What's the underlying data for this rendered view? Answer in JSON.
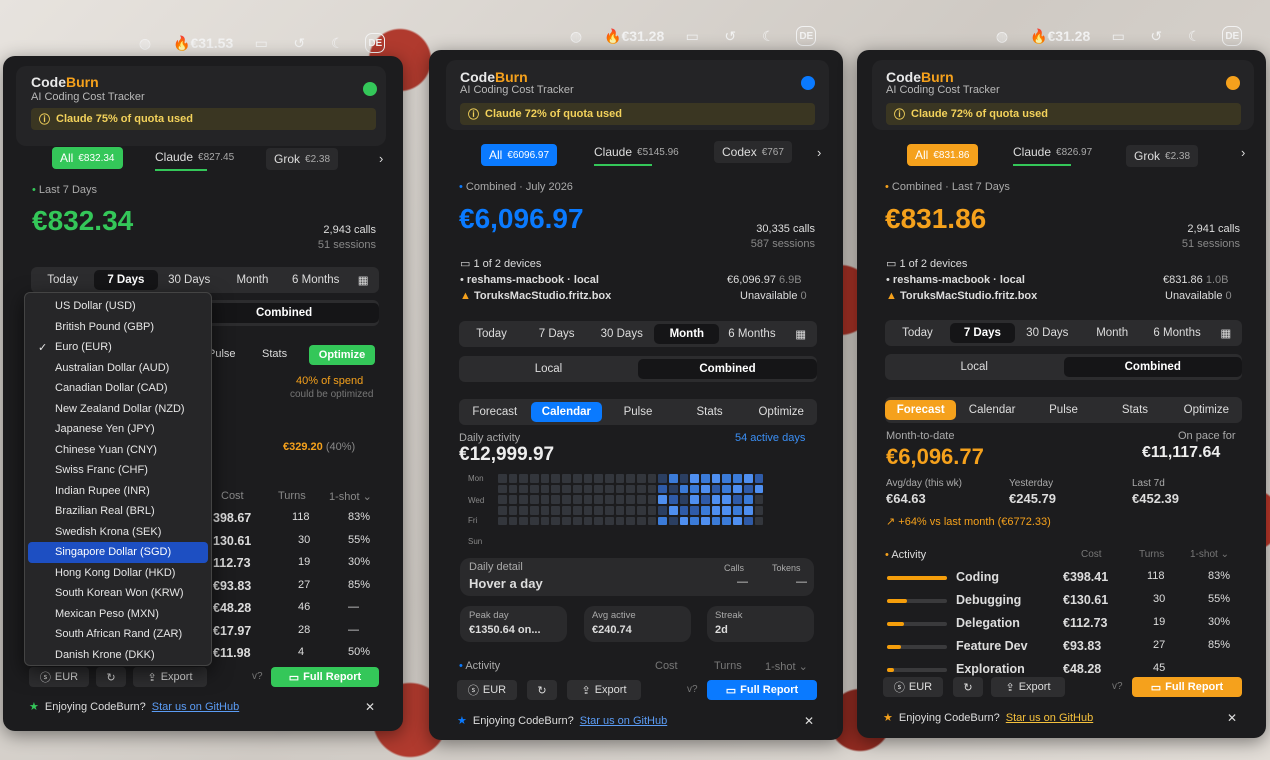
{
  "colors": {
    "green": "#34c759",
    "blue": "#0a7aff",
    "orange": "#f5a11c"
  },
  "app": {
    "brand_code": "Code",
    "brand_burn": "Burn",
    "subtitle": "AI Coding Cost Tracker"
  },
  "p1": {
    "menu_cost": "€31.53",
    "lang": "DE",
    "quota": "Claude 75% of quota used",
    "tabs": [
      {
        "label": "All",
        "value": "€832.34"
      },
      {
        "label": "Claude",
        "value": "€827.45"
      },
      {
        "label": "Grok",
        "value": "€2.38"
      }
    ],
    "period_label": "Last 7 Days",
    "total": "€832.34",
    "calls": "2,943 calls",
    "sessions": "51 sessions",
    "ranges": [
      "Today",
      "7 Days",
      "30 Days",
      "Month",
      "6 Months"
    ],
    "combined": "Combined",
    "subtabs": [
      "Pulse",
      "Stats",
      "Optimize"
    ],
    "spend_note": "40% of spend",
    "spend_sub": "could be optimized",
    "opt_value": "€329.20",
    "opt_pct": "(40%)",
    "col_cost": "Cost",
    "col_turns": "Turns",
    "col_oneshot": "1-shot",
    "rows": [
      [
        "398.67",
        "118",
        "83%"
      ],
      [
        "130.61",
        "30",
        "55%"
      ],
      [
        "112.73",
        "19",
        "30%"
      ],
      [
        "€93.83",
        "27",
        "85%"
      ],
      [
        "€48.28",
        "46",
        "—"
      ],
      [
        "€17.97",
        "28",
        "—"
      ],
      [
        "€11.98",
        "4",
        "50%"
      ]
    ],
    "currencies": [
      "US Dollar (USD)",
      "British Pound (GBP)",
      "Euro (EUR)",
      "Australian Dollar (AUD)",
      "Canadian Dollar (CAD)",
      "New Zealand Dollar (NZD)",
      "Japanese Yen (JPY)",
      "Chinese Yuan (CNY)",
      "Swiss Franc (CHF)",
      "Indian Rupee (INR)",
      "Brazilian Real (BRL)",
      "Swedish Krona (SEK)",
      "Singapore Dollar (SGD)",
      "Hong Kong Dollar (HKD)",
      "South Korean Won (KRW)",
      "Mexican Peso (MXN)",
      "South African Rand (ZAR)",
      "Danish Krone (DKK)"
    ],
    "eur": "EUR",
    "export": "Export",
    "version": "v?",
    "full_report": "Full Report",
    "enjoy": "Enjoying CodeBurn?",
    "star": "Star us on GitHub"
  },
  "p2": {
    "menu_cost": "€31.28",
    "lang": "DE",
    "quota": "Claude 72% of quota used",
    "tabs": [
      {
        "label": "All",
        "value": "€6096.97"
      },
      {
        "label": "Claude",
        "value": "€5145.96"
      },
      {
        "label": "Codex",
        "value": "€767"
      }
    ],
    "period_label": "Combined · July 2026",
    "total": "€6,096.97",
    "calls": "30,335 calls",
    "sessions": "587 sessions",
    "devices": "1 of 2 devices",
    "dev1": "reshams-macbook · local",
    "dev1_val": "€6,096.97",
    "dev1_sub": "6.9B",
    "dev2": "ToruksMacStudio.fritz.box",
    "dev2_val": "Unavailable",
    "dev2_sub": "0",
    "ranges": [
      "Today",
      "7 Days",
      "30 Days",
      "Month",
      "6 Months"
    ],
    "local": "Local",
    "combined": "Combined",
    "subtabs": [
      "Forecast",
      "Calendar",
      "Pulse",
      "Stats",
      "Optimize"
    ],
    "daily_activity": "Daily activity",
    "active_days": "54 active days",
    "daily_total": "€12,999.97",
    "days": [
      "Mon",
      "Wed",
      "Fri",
      "Sun"
    ],
    "detail_label": "Daily detail",
    "detail_value": "Hover a day",
    "calls_label": "Calls",
    "calls_val": "—",
    "tokens_label": "Tokens",
    "tokens_val": "—",
    "peak_label": "Peak day",
    "peak_val": "€1350.64 on...",
    "avg_label": "Avg active",
    "avg_val": "€240.74",
    "streak_label": "Streak",
    "streak_val": "2d",
    "activity": "Activity",
    "col_cost": "Cost",
    "col_turns": "Turns",
    "col_oneshot": "1-shot",
    "eur": "EUR",
    "export": "Export",
    "version": "v?",
    "full_report": "Full Report",
    "enjoy": "Enjoying CodeBurn?",
    "star": "Star us on GitHub"
  },
  "p3": {
    "menu_cost": "€31.28",
    "lang": "DE",
    "quota": "Claude 72% of quota used",
    "tabs": [
      {
        "label": "All",
        "value": "€831.86"
      },
      {
        "label": "Claude",
        "value": "€826.97"
      },
      {
        "label": "Grok",
        "value": "€2.38"
      }
    ],
    "period_label": "Combined · Last 7 Days",
    "total": "€831.86",
    "calls": "2,941 calls",
    "sessions": "51 sessions",
    "devices": "1 of 2 devices",
    "dev1": "reshams-macbook · local",
    "dev1_val": "€831.86",
    "dev1_sub": "1.0B",
    "dev2": "ToruksMacStudio.fritz.box",
    "dev2_val": "Unavailable",
    "dev2_sub": "0",
    "ranges": [
      "Today",
      "7 Days",
      "30 Days",
      "Month",
      "6 Months"
    ],
    "local": "Local",
    "combined": "Combined",
    "subtabs": [
      "Forecast",
      "Calendar",
      "Pulse",
      "Stats",
      "Optimize"
    ],
    "mtd_label": "Month-to-date",
    "mtd_val": "€6,096.77",
    "pace_label": "On pace for",
    "pace_val": "€11,117.64",
    "avg_label": "Avg/day (this wk)",
    "avg_val": "€64.63",
    "yest_label": "Yesterday",
    "yest_val": "€245.79",
    "last7_label": "Last 7d",
    "last7_val": "€452.39",
    "trend": "↗ +64% vs last month (€6772.33)",
    "activity": "Activity",
    "col_cost": "Cost",
    "col_turns": "Turns",
    "col_oneshot": "1-shot",
    "acts": [
      {
        "name": "Coding",
        "cost": "€398.41",
        "turns": "118",
        "shot": "83%",
        "frac": 1.0
      },
      {
        "name": "Debugging",
        "cost": "€130.61",
        "turns": "30",
        "shot": "55%",
        "frac": 0.33
      },
      {
        "name": "Delegation",
        "cost": "€112.73",
        "turns": "19",
        "shot": "30%",
        "frac": 0.28
      },
      {
        "name": "Feature Dev",
        "cost": "€93.83",
        "turns": "27",
        "shot": "85%",
        "frac": 0.24
      },
      {
        "name": "Exploration",
        "cost": "€48.28",
        "turns": "45",
        "shot": "",
        "frac": 0.12
      }
    ],
    "eur": "EUR",
    "export": "Export",
    "version": "v?",
    "full_report": "Full Report",
    "enjoy": "Enjoying CodeBurn?",
    "star": "Star us on GitHub"
  }
}
